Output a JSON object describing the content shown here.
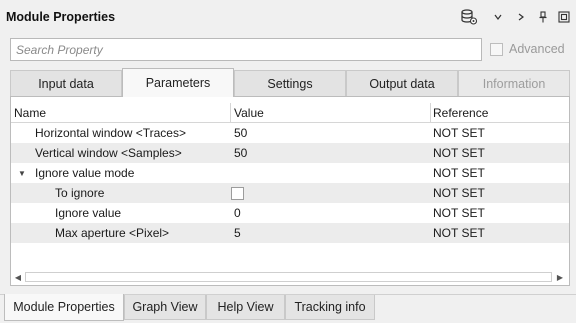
{
  "window": {
    "title": "Module Properties",
    "icons": [
      "database-settings-icon",
      "chevron-down-icon",
      "chevron-right-icon",
      "pin-icon",
      "restore-window-icon"
    ]
  },
  "search": {
    "value": "",
    "placeholder": "Search Property"
  },
  "advanced": {
    "label": "Advanced",
    "checked": false
  },
  "tabs": [
    {
      "label": "Input data",
      "active": false,
      "enabled": true
    },
    {
      "label": "Parameters",
      "active": true,
      "enabled": true
    },
    {
      "label": "Settings",
      "active": false,
      "enabled": true
    },
    {
      "label": "Output data",
      "active": false,
      "enabled": true
    },
    {
      "label": "Information",
      "active": false,
      "enabled": false
    }
  ],
  "table": {
    "columns": [
      "Name",
      "Value",
      "Reference"
    ],
    "rows": [
      {
        "name": "Horizontal window <Traces>",
        "value": "50",
        "reference": "NOT SET",
        "level": 1
      },
      {
        "name": "Vertical window <Samples>",
        "value": "50",
        "reference": "NOT SET",
        "level": 1
      },
      {
        "name": "Ignore value mode",
        "value": "",
        "reference": "NOT SET",
        "level": 0,
        "expanded": true
      },
      {
        "name": "To ignore",
        "value": "",
        "checkbox": true,
        "checked": false,
        "reference": "NOT SET",
        "level": 2
      },
      {
        "name": "Ignore value",
        "value": "0",
        "reference": "NOT SET",
        "level": 2
      },
      {
        "name": "Max aperture <Pixel>",
        "value": "5",
        "reference": "NOT SET",
        "level": 2
      }
    ]
  },
  "bottom_tabs": [
    {
      "label": "Module Properties",
      "active": true
    },
    {
      "label": "Graph View",
      "active": false
    },
    {
      "label": "Help View",
      "active": false
    },
    {
      "label": "Tracking info",
      "active": false
    }
  ]
}
